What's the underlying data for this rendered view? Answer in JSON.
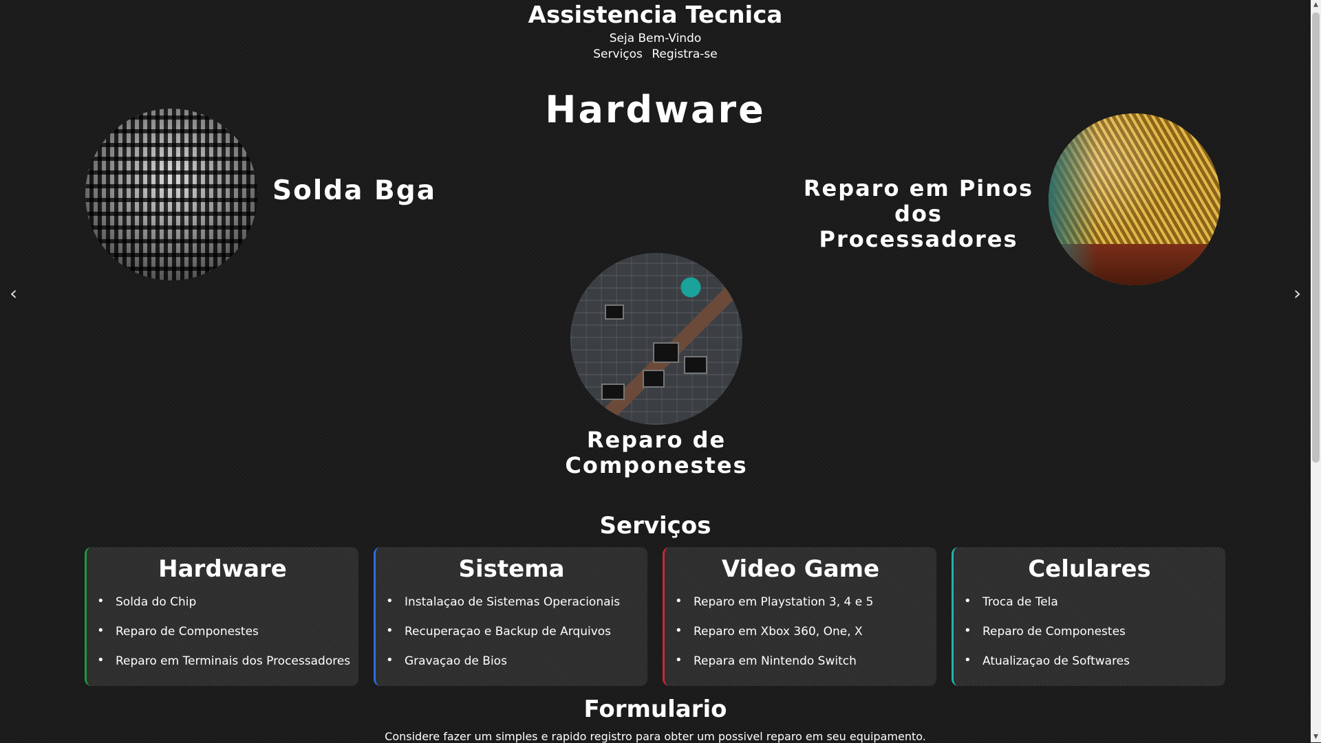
{
  "header": {
    "title": "Assistencia Tecnica",
    "welcome": "Seja Bem-Vindo",
    "nav": [
      "Serviços",
      "Registra-se"
    ]
  },
  "carousel": {
    "heading": "Hardware",
    "slides": [
      {
        "label": "Solda Bga",
        "image": "bga-solder-balls-image"
      },
      {
        "label_lines": [
          "Reparo em Pinos",
          "dos Processadores"
        ],
        "image": "processor-pins-image"
      },
      {
        "label_lines": [
          "Reparo de",
          "Componestes"
        ],
        "image": "circuit-board-soldering-image"
      }
    ],
    "prev_icon": "‹",
    "next_icon": "›"
  },
  "services": {
    "title": "Serviços",
    "cards": [
      {
        "title": "Hardware",
        "accent": "#1e9a3c",
        "items": [
          "Solda do Chip",
          "Reparo de Componestes",
          "Reparo em Terminais dos Processadores"
        ]
      },
      {
        "title": "Sistema",
        "accent": "#2a6fe0",
        "items": [
          "Instalaçao de Sistemas Operacionais",
          "Recuperaçao e Backup de Arquivos",
          "Gravaçao de Bios"
        ]
      },
      {
        "title": "Video Game",
        "accent": "#c8283a",
        "items": [
          "Reparo em Playstation 3, 4 e 5",
          "Reparo em Xbox 360, One, X",
          "Repara em Nintendo Switch"
        ]
      },
      {
        "title": "Celulares",
        "accent": "#1fb6a8",
        "items": [
          "Troca de Tela",
          "Reparo de Componestes",
          "Atualizaçao de Softwares"
        ]
      }
    ]
  },
  "form": {
    "title": "Formulario",
    "description": "Considere fazer um simples e rapido registro para obter um possivel reparo em seu equipamento."
  },
  "colors": {
    "background": "#1b1b1b",
    "card": "#2c2c2c",
    "text": "#ffffff"
  }
}
